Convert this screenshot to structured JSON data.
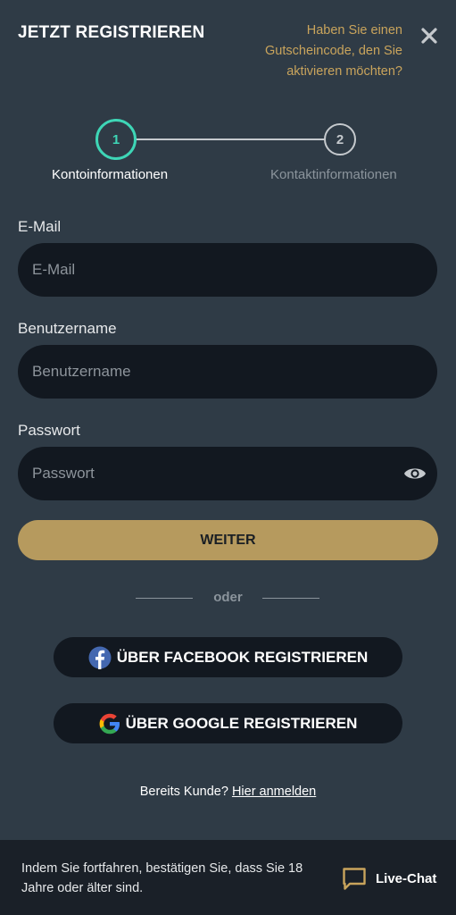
{
  "header": {
    "title": "JETZT REGISTRIEREN",
    "voucher_link": "Haben Sie einen Gutscheincode, den Sie aktivieren möchten?"
  },
  "stepper": {
    "steps": [
      {
        "number": "1",
        "label": "Kontoinformationen",
        "active": true
      },
      {
        "number": "2",
        "label": "Kontaktinformationen",
        "active": false
      }
    ]
  },
  "form": {
    "email": {
      "label": "E-Mail",
      "placeholder": "E-Mail",
      "value": ""
    },
    "username": {
      "label": "Benutzername",
      "placeholder": "Benutzername",
      "value": ""
    },
    "password": {
      "label": "Passwort",
      "placeholder": "Passwort",
      "value": ""
    },
    "submit_label": "WEITER"
  },
  "divider_text": "oder",
  "social": {
    "facebook_label": "ÜBER FACEBOOK REGISTRIEREN",
    "google_label": "ÜBER GOOGLE REGISTRIEREN"
  },
  "login_prompt": {
    "text": "Bereits Kunde?",
    "link": "Hier anmelden"
  },
  "footer": {
    "notice": "Indem Sie fortfahren, bestätigen Sie, dass Sie 18 Jahre oder älter sind.",
    "chat_label": "Live-Chat"
  },
  "colors": {
    "background": "#2f3b46",
    "accent_gold": "#b69a5e",
    "accent_teal": "#3ed6b6",
    "input_bg": "#121820"
  },
  "icons": [
    "close-icon",
    "eye-icon",
    "facebook-icon",
    "google-icon",
    "chat-icon"
  ]
}
